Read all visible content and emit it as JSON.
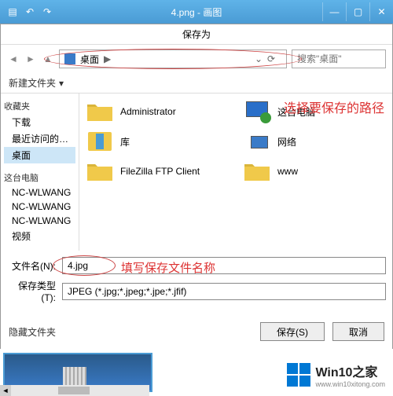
{
  "titlebar": {
    "title": "4.png - 画图"
  },
  "dialog": {
    "title": "保存为",
    "breadcrumb": "桌面",
    "breadcrumb_sep": "▶",
    "search_placeholder": "搜索\"桌面\"",
    "new_folder": "新建文件夹",
    "annotation_path": "选择要保存的路径",
    "annotation_name": "填写保存文件名称",
    "filename_label": "文件名(N):",
    "filename_value": "4.jpg",
    "filetype_label": "保存类型(T):",
    "filetype_value": "JPEG (*.jpg;*.jpeg;*.jpe;*.jfif)",
    "hide_folders": "隐藏文件夹",
    "save_btn": "保存(S)",
    "cancel_btn": "取消"
  },
  "sidebar": {
    "fav": "收藏夹",
    "items": [
      "下载",
      "最近访问的位置",
      "桌面"
    ],
    "pc": "这台电脑",
    "pc_items": [
      "NC-WLWANG",
      "NC-WLWANG",
      "NC-WLWANG"
    ],
    "video": "视频"
  },
  "content_items": {
    "0": "Administrator",
    "1": "这台电脑",
    "2": "库",
    "3": "网络",
    "4": "FileZilla FTP Client",
    "5": "www"
  },
  "logo": {
    "text": "Win10之家",
    "url": "www.win10xitong.com"
  }
}
